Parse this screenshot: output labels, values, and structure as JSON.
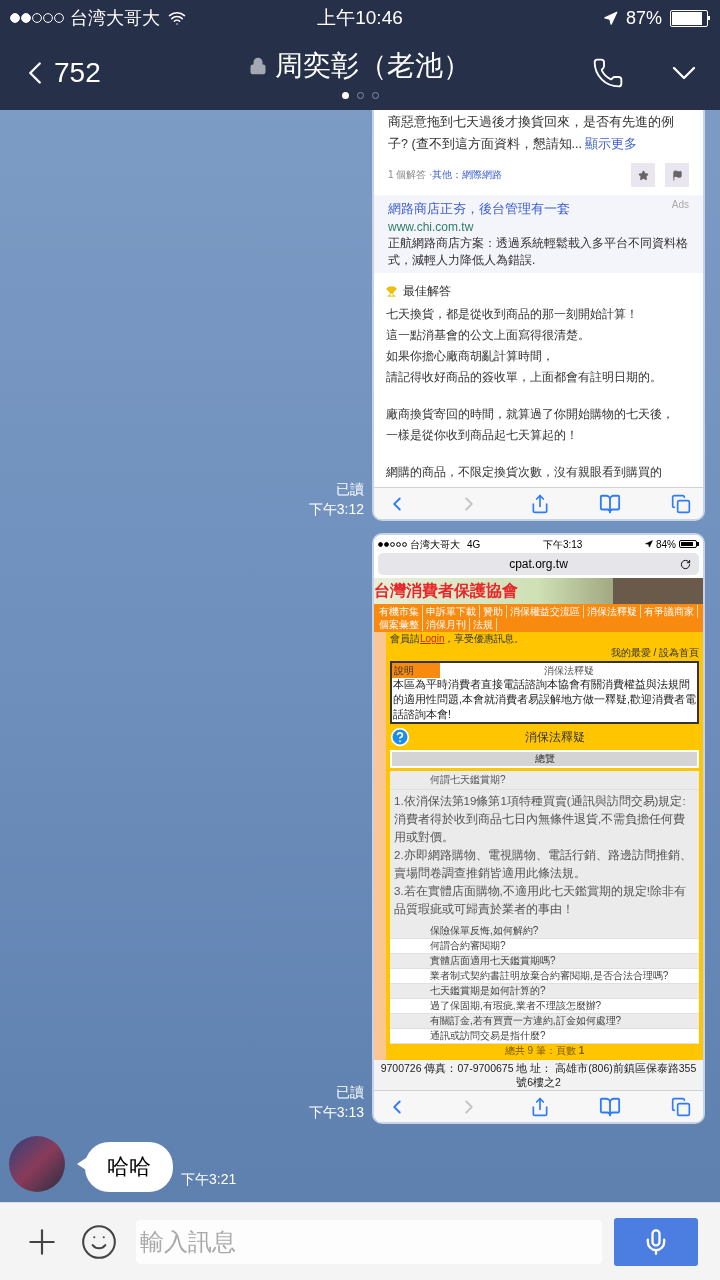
{
  "status_bar": {
    "carrier": "台湾大哥大",
    "time": "上午10:46",
    "battery": "87%"
  },
  "header": {
    "back_count": "752",
    "title": "周奕彰（老池）",
    "page_dots": [
      {
        "selected": true
      },
      {
        "selected": false
      },
      {
        "selected": false
      }
    ]
  },
  "messages": [
    {
      "kind": "answer_screenshot",
      "read": "已讀",
      "time": "下午3:12",
      "screenshot": {
        "question": "商惡意拖到七天過後才換貨回來，是否有先進的例子? (查不到這方面資料，懇請知... ",
        "more_link": "顯示更多",
        "answer_count": "1 個解答 · ",
        "category": "其他：網際網路",
        "ad": {
          "title": "網路商店正夯，後台管理有一套",
          "label": "Ads",
          "url": "www.chi.com.tw",
          "description": "正航網路商店方案：透過系統輕鬆載入多平台不同資料格式，減輕人力降低人為錯誤."
        },
        "best_answer": {
          "heading": "最佳解答",
          "paragraphs": [
            [
              "七天換貨，都是從收到商品的那一刻開始計算！",
              "這一點消基會的公文上面寫得很清楚。",
              "如果你擔心廠商胡亂計算時間，",
              "請記得收好商品的簽收單，上面都會有註明日期的。"
            ],
            [
              "廠商換貨寄回的時間，就算過了你開始購物的七天後，",
              "一樣是從你收到商品起七天算起的！"
            ],
            [
              "網購的商品，不限定換貨次數，沒有親眼看到購買的"
            ]
          ]
        }
      }
    },
    {
      "kind": "website_screenshot",
      "read": "已讀",
      "time": "下午3:13",
      "screenshot": {
        "status": {
          "carrier": "台湾大哥大",
          "network": "4G",
          "time": "下午3:13",
          "battery": "84%"
        },
        "url": "cpat.org.tw",
        "banner_title": "台灣消費者保護協會",
        "nav": [
          "有機市集",
          "申訴單下載",
          "贊助",
          "消保權益交流區",
          "消保法釋疑",
          "有爭議商家",
          "個案彙整",
          "消保月刊",
          "法規"
        ],
        "member": {
          "prefix": "會員請",
          "link": "Login",
          "suffix": "，享受優惠訊息。"
        },
        "top_links": "我的最愛 / 設為首頁",
        "intro": {
          "tab": "說明",
          "heading": "消保法釋疑",
          "text": "本區為平時消費者直接電話諮詢本協會有關消費權益與法規間的適用性問題,本會就消費者易誤解地方做一釋疑,歡迎消費者電話諮詢本會!"
        },
        "section_title": "消保法釋疑",
        "overview": "總覽",
        "faq": [
          {
            "question": "何謂七天鑑賞期?",
            "expanded": true,
            "answer": [
              "1.依消保法第19條第1項特種買賣(通訊與訪問交易)規定:消費者得於收到商品七日內無條件退貨,不需負擔任何費用或對價。",
              "2.亦即網路購物、電視購物、電話行銷、路邊訪問推銷、賣場問卷調查推銷皆適用此條法規。",
              "3.若在實體店面購物,不適用此七天鑑賞期的規定!除非有品質瑕疵或可歸責於業者的事由！"
            ]
          },
          {
            "question": "保險保單反悔,如何解約?",
            "expanded": false
          },
          {
            "question": "何謂合約審閱期?",
            "expanded": false
          },
          {
            "question": "實體店面適用七天鑑賞期嗎?",
            "expanded": false
          },
          {
            "question": "業者制式契約書註明放棄合約審閱期,是否合法合理嗎?",
            "expanded": false
          },
          {
            "question": "七天鑑賞期是如何計算的?",
            "expanded": false
          },
          {
            "question": "過了保固期,有瑕疵,業者不理該怎麼辦?",
            "expanded": false
          },
          {
            "question": "有關訂金,若有買賣一方違約,訂金如何處理?",
            "expanded": false
          },
          {
            "question": "通訊或訪問交易是指什麼?",
            "expanded": false
          }
        ],
        "pager": "總共 9 筆：頁數 **1**",
        "footer": "9700726 傳真：07-9700675 地 址： 高雄市(806)前鎮區保泰路355號6樓之2"
      }
    },
    {
      "kind": "incoming_text",
      "text": "哈哈",
      "time": "下午3:21"
    }
  ],
  "composer": {
    "placeholder": "輸入訊息"
  }
}
